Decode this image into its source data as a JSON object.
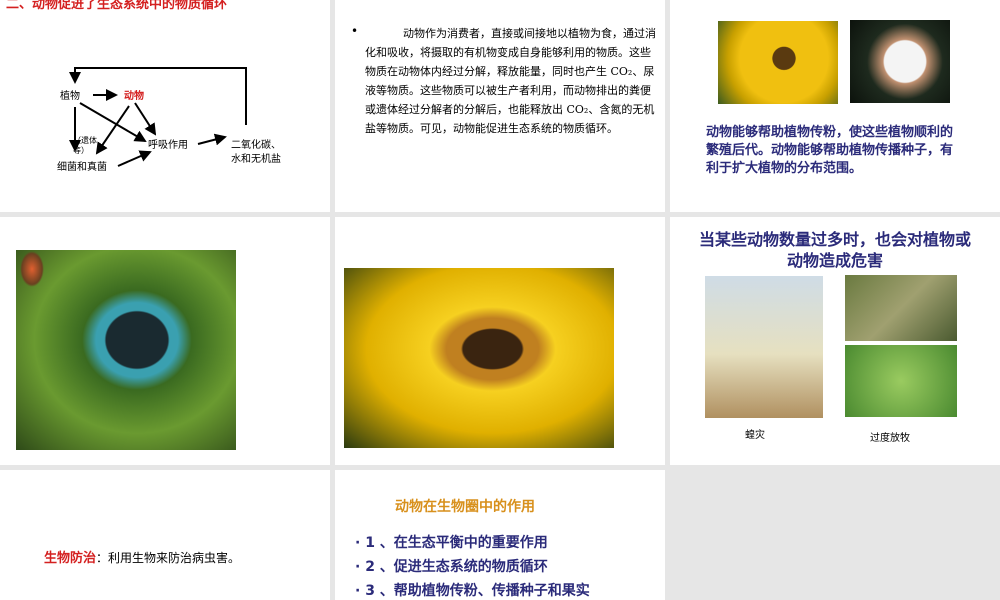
{
  "slide1": {
    "title": "二、动物促进了生态系统中的物质循环",
    "plant": "植物",
    "animal": "动物",
    "respiration": "呼吸作用",
    "remains": "（遗体等）",
    "decomposers": "细菌和真菌",
    "products_line1": "二氧化碳、",
    "products_line2": "水和无机盐"
  },
  "slide2": {
    "bullet": "•",
    "text": "动物作为消费者，直接或间接地以植物为食，通过消化和吸收，将摄取的有机物变成自身能够利用的物质。这些物质在动物体内经过分解，释放能量，同时也产生 CO₂、尿液等物质。这些物质可以被生产者利用，而动物排出的粪便或遗体经过分解者的分解后，也能释放出 CO₂、含氮的无机盐等物质。可见，动物能促进生态系统的物质循环。"
  },
  "slide3": {
    "text": "动物能够帮助植物传粉，使这些植物顺利的繁殖后代。动物能够帮助植物传播种子，有利于扩大植物的分布范围。"
  },
  "slide6": {
    "title": "当某些动物数量过多时，也会对植物或动物造成危害",
    "caption_locust": "蝗灾",
    "caption_grazing": "过度放牧"
  },
  "slide7": {
    "term": "生物防治",
    "text": "：利用生物来防治病虫害。"
  },
  "slide8": {
    "title": "动物在生物圈中的作用",
    "items": [
      "· 1 、在生态平衡中的重要作用",
      "· 2 、促进生态系统的物质循环",
      "· 3 、帮助植物传粉、传播种子和果实"
    ]
  }
}
